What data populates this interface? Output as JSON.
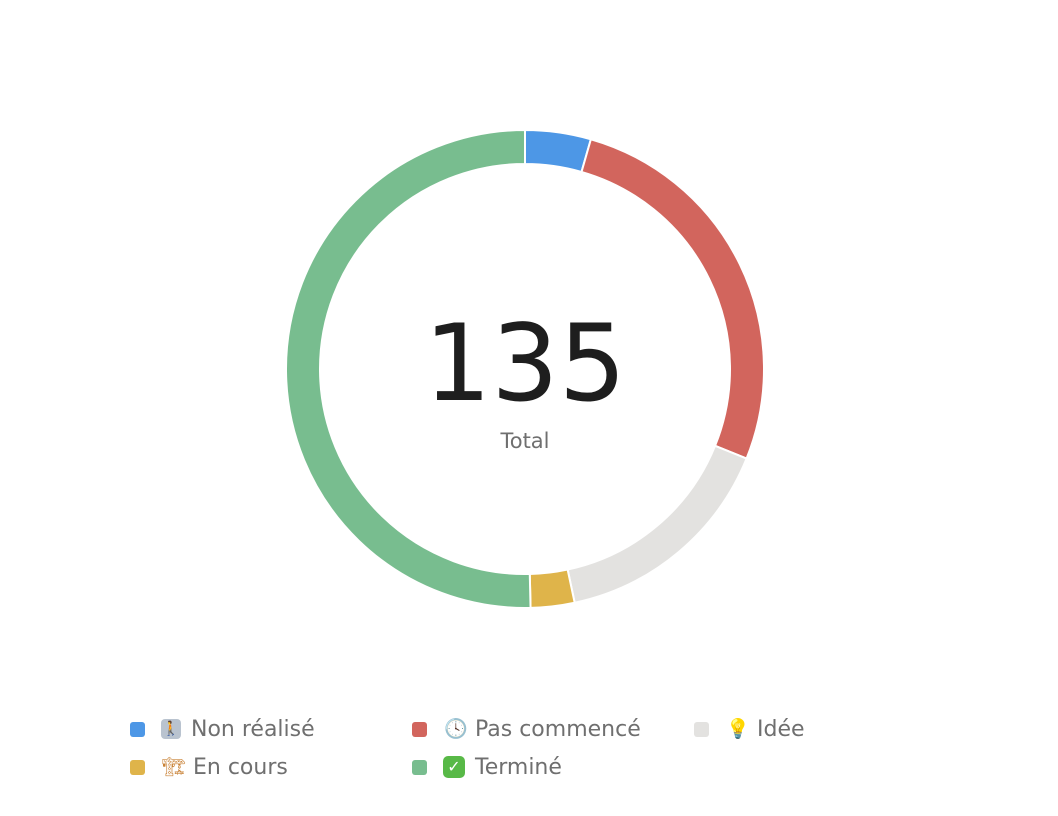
{
  "chart_data": {
    "type": "pie",
    "variant": "donut",
    "center_value": "135",
    "center_label": "Total",
    "legend_placement": "bottom",
    "start": "top",
    "direction": "clockwise",
    "slices": [
      {
        "label": "Non réalisé",
        "icon": "person-icon",
        "value": 6,
        "color": "#4d97e6"
      },
      {
        "label": "Pas commencé",
        "icon": "clock-icon",
        "value": 36,
        "color": "#d2655d"
      },
      {
        "label": "Idée",
        "icon": "lightbulb-icon",
        "value": 21,
        "color": "#e3e2e0"
      },
      {
        "label": "En cours",
        "icon": "construction-crane-icon",
        "value": 4,
        "color": "#dfb44a"
      },
      {
        "label": "Terminé",
        "icon": "check-mark-icon",
        "value": 68,
        "color": "#78bd8f"
      }
    ]
  }
}
